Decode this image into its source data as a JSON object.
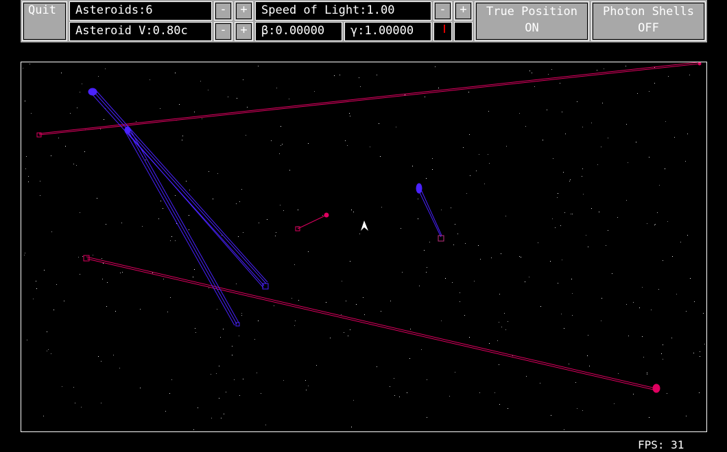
{
  "toolbar": {
    "quit_label": "Quit",
    "asteroids_label": "Asteroids:6",
    "asteroid_v_label": "Asteroid V:0.80c",
    "speed_of_light_label": "Speed of Light:1.00",
    "beta_label": "β:0.00000",
    "gamma_label": "γ:1.00000",
    "minus": "-",
    "plus": "+",
    "true_position": {
      "label": "True Position",
      "state": "ON"
    },
    "photon_shells": {
      "label": "Photon Shells",
      "state": "OFF"
    }
  },
  "hud": {
    "fps_label": "FPS: 31"
  },
  "colors": {
    "ui_gray": "#a8a8a8",
    "blue_asteroid": "#4a22ff",
    "red_asteroid": "#e00060",
    "ship": "#ffffff",
    "indicator_red": "#e00000"
  },
  "icons": [
    "ship-icon",
    "asteroid-marker",
    "heading-indicator"
  ]
}
